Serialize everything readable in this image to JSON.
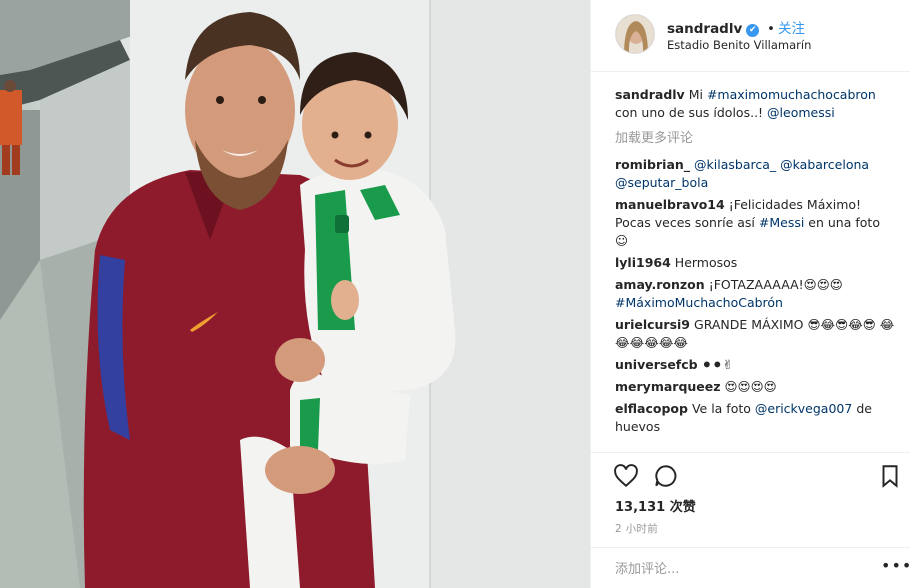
{
  "post": {
    "username": "sandradlv",
    "follow_label": "关注",
    "separator": "•",
    "verified_glyph": "✔",
    "location": "Estadio Benito Villamarín"
  },
  "caption": {
    "username": "sandradlv",
    "text_1": "Mi ",
    "hashtag": "#maximomuchachocabron",
    "text_2": " con uno de sus ídolos..! ",
    "mention": "@leomessi"
  },
  "load_more_label": "加载更多评论",
  "comments": [
    {
      "user": "romibrian_",
      "text": "",
      "link_1": "@kilasbarca_",
      "mid": " ",
      "link_2": "@kabarcelona",
      "mid2": " ",
      "link_3": "@seputar_bola"
    },
    {
      "user": "manuelbravo14",
      "text": "¡Felicidades Máximo! Pocas veces sonríe así ",
      "link_1": "#Messi",
      "after": " en una foto",
      "emoji": "☺"
    },
    {
      "user": "lyli1964",
      "text": "Hermosos"
    },
    {
      "user": "amay.ronzon",
      "text": "¡FOTAZAAAAA!",
      "emoji": "😍😍😍",
      "link_1": "#MáximoMuchachoCabrón"
    },
    {
      "user": "urielcursi9",
      "text": "GRANDE MÁXIMO ",
      "emoji": "😎😂😎😂😎 😂😂😂😂😂😂"
    },
    {
      "user": "universefcb",
      "text": "",
      "emoji": "⚫⚫✌"
    },
    {
      "user": "merymarqueez",
      "text": "",
      "emoji": "😍😍😍😍"
    },
    {
      "user": "elflacopop",
      "text": "Ve la foto ",
      "link_1": "@erickvega007",
      "after": " de huevos"
    }
  ],
  "actions": {
    "likes": "13,131 次赞",
    "time": "2 小时前",
    "add_comment_placeholder": "添加评论...",
    "more_label": "•••"
  },
  "icons": {
    "like": "heart-icon",
    "comment": "comment-bubble-icon",
    "save": "bookmark-icon",
    "more": "more-options-icon"
  },
  "colors": {
    "link": "#003569",
    "follow": "#3897f0",
    "muted": "#999999",
    "jersey_red": "#8e1b2c",
    "betis_green": "#1a9a4b"
  }
}
